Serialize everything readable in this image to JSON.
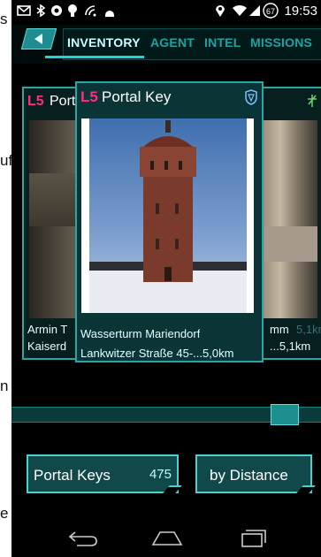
{
  "side_fragments": [
    "s",
    "uf",
    "n",
    "e"
  ],
  "status": {
    "time": "19:53",
    "battery": "67"
  },
  "tabs": {
    "inventory": "INVENTORY",
    "agent": "AGENT",
    "intel": "INTEL",
    "missions": "MISSIONS"
  },
  "card_left": {
    "level": "L5",
    "title": "Port",
    "name": "Armin T",
    "address": "Kaiserd"
  },
  "card_right": {
    "name_frag": "mm",
    "dist_frag": "5,1km",
    "addr_frag": "...5,1km"
  },
  "card_main": {
    "level": "L5",
    "title": "Portal Key",
    "name": "Wasserturm Mariendorf",
    "address": "Lankwitzer Straße 45-...5,0km"
  },
  "buttons": {
    "filter_label": "Portal Keys",
    "filter_count": "475",
    "sort_label": "by Distance"
  },
  "colors": {
    "accent": "#2aa7a5",
    "level": "#ff2f7f",
    "tab_active": "#c9ffff",
    "tab": "#1aa5a1"
  }
}
